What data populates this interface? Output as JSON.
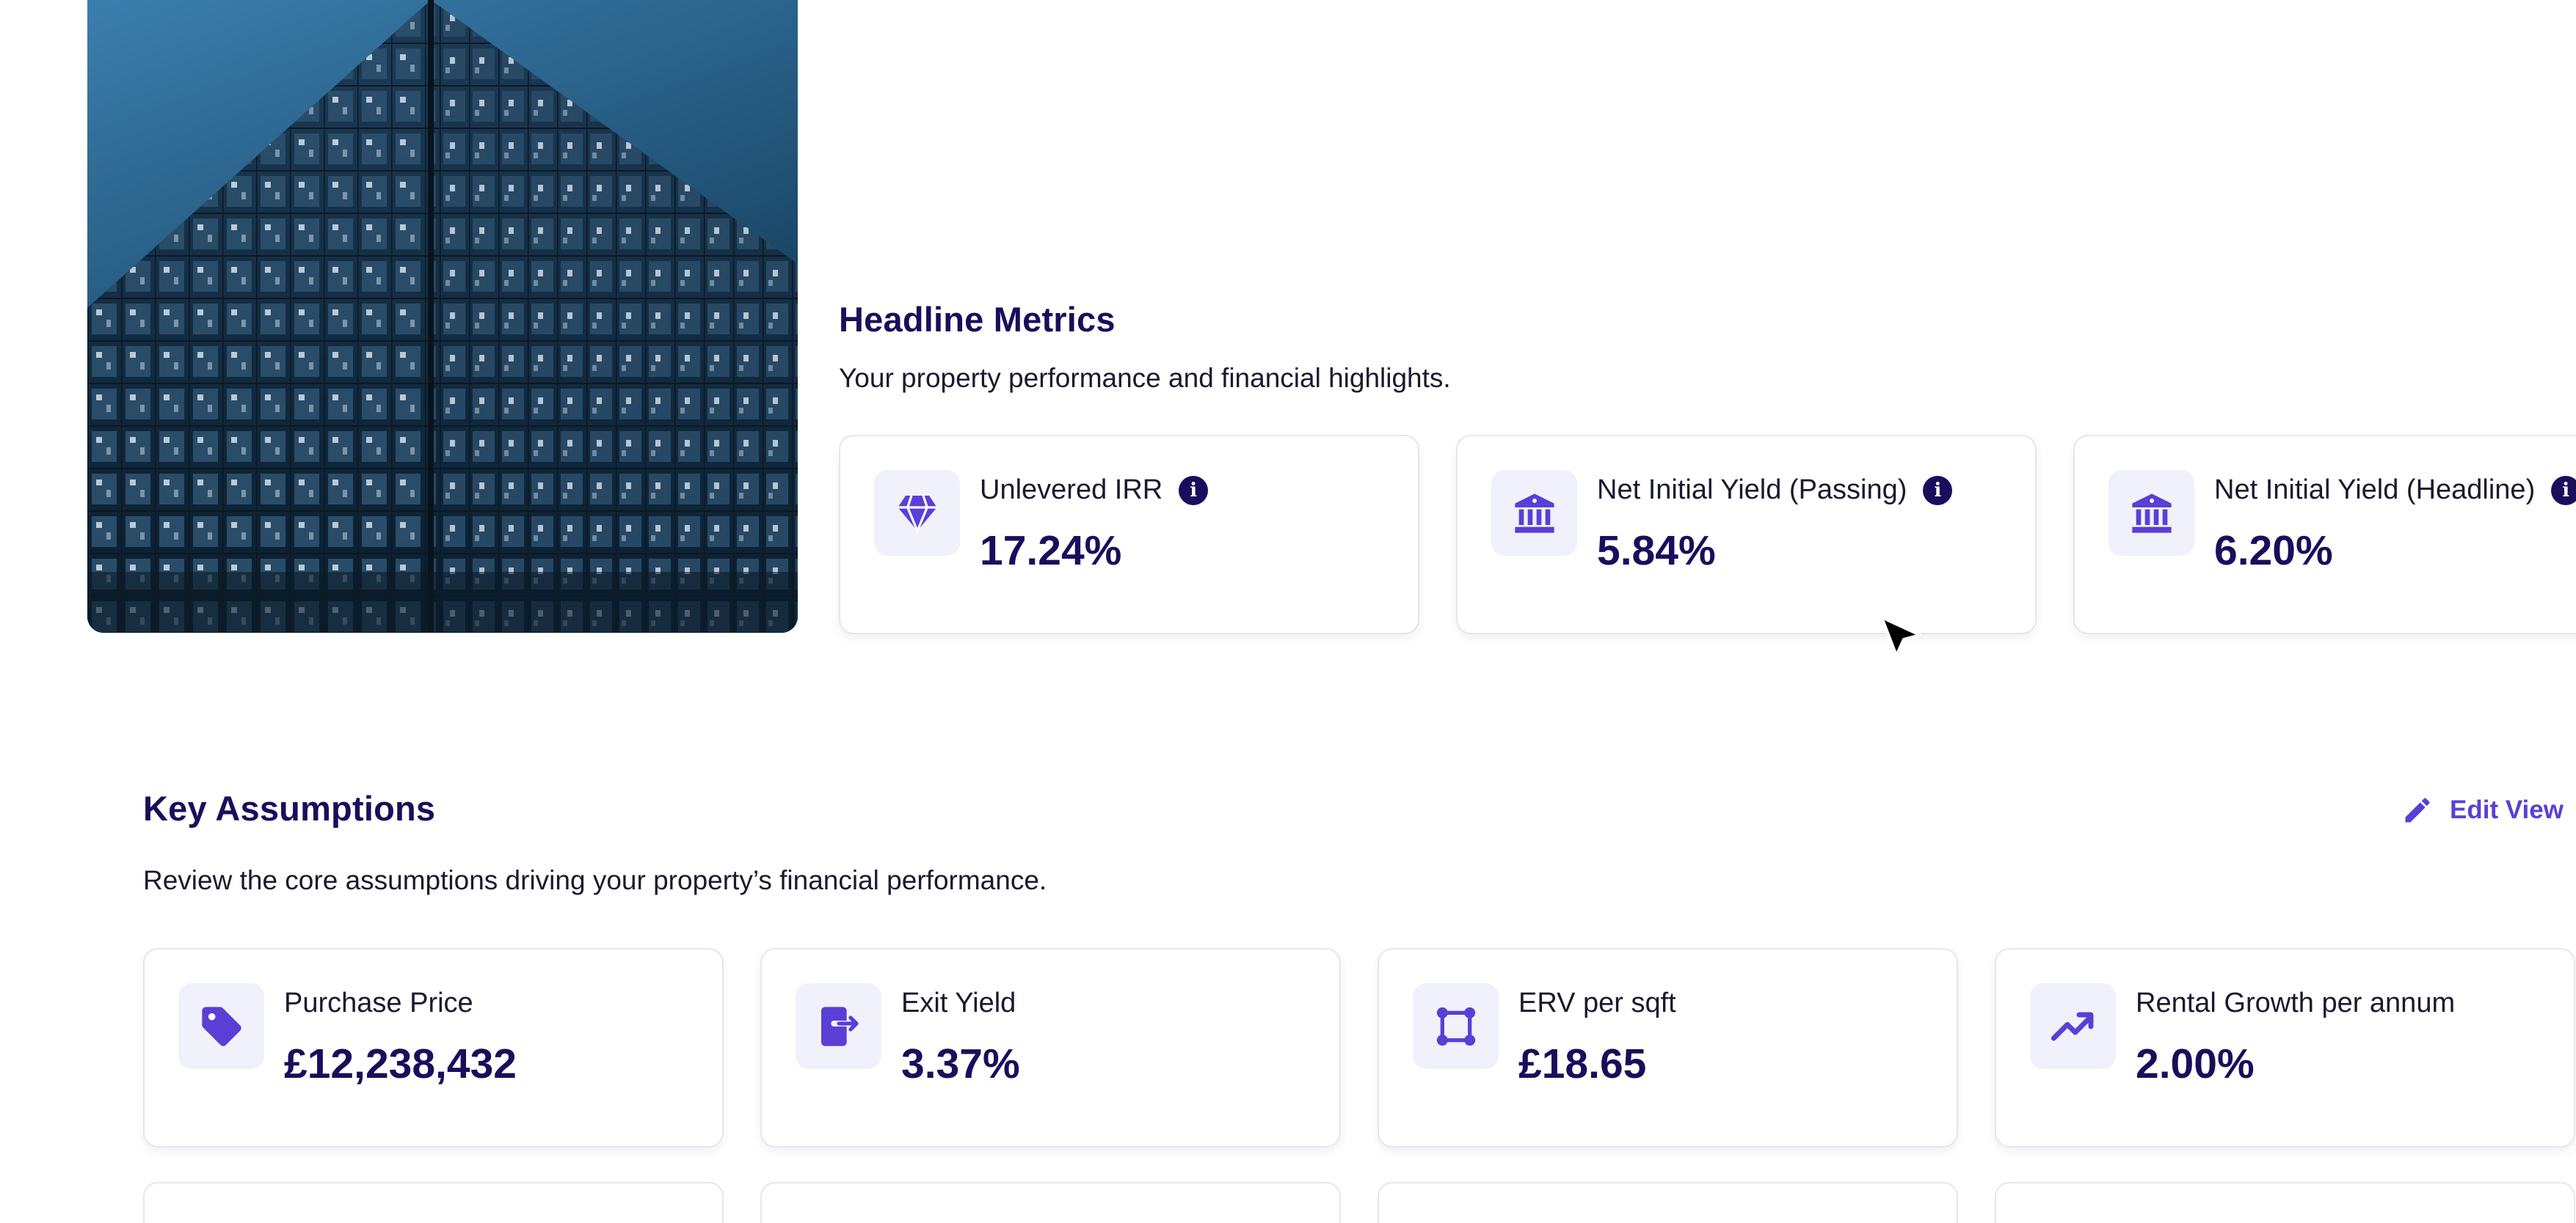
{
  "headline": {
    "title": "Headline Metrics",
    "subtitle": "Your property performance and financial highlights.",
    "cards": [
      {
        "icon": "diamond-icon",
        "label": "Unlevered IRR",
        "value": "17.24%",
        "info": true
      },
      {
        "icon": "bank-icon",
        "label": "Net Initial Yield (Passing)",
        "value": "5.84%",
        "info": true
      },
      {
        "icon": "bank-icon",
        "label": "Net Initial Yield (Headline)",
        "value": "6.20%",
        "info": true
      }
    ]
  },
  "assumptions": {
    "title": "Key Assumptions",
    "subtitle": "Review the core assumptions driving your property’s financial performance.",
    "edit_label": "Edit View",
    "cards": [
      {
        "icon": "tag-icon",
        "label": "Purchase Price",
        "value": "£12,238,432"
      },
      {
        "icon": "exit-icon",
        "label": "Exit Yield",
        "value": "3.37%"
      },
      {
        "icon": "area-icon",
        "label": "ERV per sqft",
        "value": "£18.65"
      },
      {
        "icon": "trending-up-icon",
        "label": "Rental Growth per annum",
        "value": "2.00%"
      }
    ]
  },
  "colors": {
    "accent": "#5a3fd6",
    "heading": "#1a0e5c",
    "icon_bg": "#f1f1fb"
  }
}
